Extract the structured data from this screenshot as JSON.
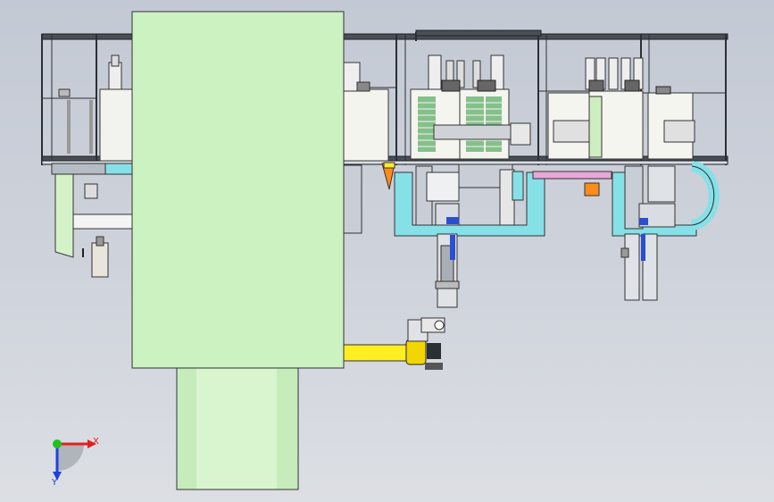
{
  "viewport": {
    "background_top": "#c3c9d4",
    "background_bottom": "#dcdfe4"
  },
  "model": {
    "frame_color": "#2b2f36",
    "green_part_color": "#ccf2c2",
    "cylinder_color": "#d8f5cf",
    "cyan_part_color": "#86e0e8",
    "yellow_part_color": "#ffee22",
    "orange_part_color": "#ff8c1a",
    "magenta_strip_color": "#e9a7d9"
  },
  "triad": {
    "x_label": "X",
    "y_label": "Y",
    "x_color": "#e02020",
    "y_color": "#2040e0",
    "origin_color": "#20c020"
  }
}
